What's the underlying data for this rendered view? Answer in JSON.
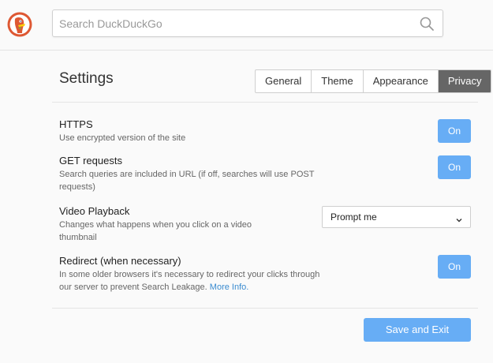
{
  "header": {
    "logo_icon": "duckduckgo-logo",
    "search_placeholder": "Search DuckDuckGo",
    "search_value": "",
    "search_icon": "magnifier-icon"
  },
  "settings": {
    "title": "Settings",
    "tabs": [
      {
        "label": "General",
        "active": false
      },
      {
        "label": "Theme",
        "active": false
      },
      {
        "label": "Appearance",
        "active": false
      },
      {
        "label": "Privacy",
        "active": true
      }
    ],
    "rows": [
      {
        "title": "HTTPS",
        "desc": "Use encrypted version of the site",
        "control": "toggle",
        "value": "On"
      },
      {
        "title": "GET requests",
        "desc_line1": "Search queries are included in URL (if off, searches will use POST",
        "desc_line2": "requests)",
        "control": "toggle",
        "value": "On"
      },
      {
        "title": "Video Playback",
        "desc_line1": "Changes what happens when you click on a video",
        "desc_line2": "thumbnail",
        "control": "select",
        "value": "Prompt me"
      },
      {
        "title": "Redirect (when necessary)",
        "desc_line1": "In some older browsers it's necessary to redirect your clicks through",
        "desc_line2": "our server to prevent Search Leakage.",
        "link": "More Info.",
        "control": "toggle",
        "value": "On"
      }
    ],
    "save_label": "Save and Exit"
  },
  "colors": {
    "accent": "#67adf5",
    "active_tab": "#666666",
    "link": "#3a8bd0",
    "logo_orange": "#de5833"
  }
}
